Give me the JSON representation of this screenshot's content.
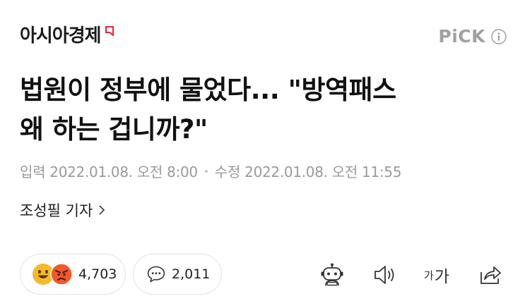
{
  "header": {
    "logo_text": "아시아경제",
    "pick_label": "PiCK"
  },
  "article": {
    "headline_line1": "법원이 정부에 물었다... \"방역패스",
    "headline_line2": "왜 하는 겁니까?\"",
    "published_label": "입력",
    "published_date": "2022.01.08. 오전 8:00",
    "modified_label": "수정",
    "modified_date": "2022.01.08. 오전 11:55",
    "reporter": "조성필 기자"
  },
  "actions": {
    "reaction_count": "4,703",
    "comment_count": "2,011",
    "font_small": "가",
    "font_big": "가"
  },
  "icons": [
    "logo-mark-icon",
    "info-icon",
    "chevron-right-icon",
    "smile-emoji-icon",
    "angry-emoji-icon",
    "comment-bubble-icon",
    "robot-icon",
    "speaker-icon",
    "share-icon"
  ],
  "colors": {
    "logo_mark": "#e0263a",
    "pick_gray": "#a0a0a0",
    "angry": "#f05a2a",
    "smile": "#f7b928"
  }
}
